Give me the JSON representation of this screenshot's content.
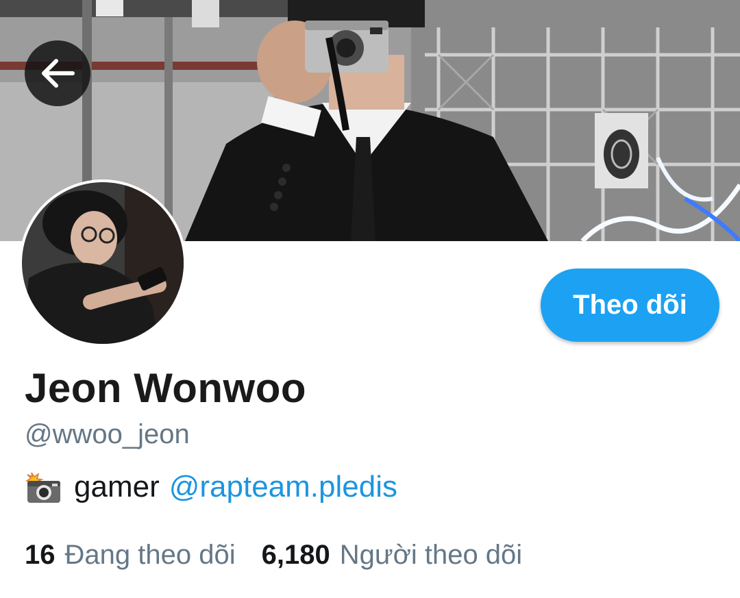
{
  "header": {
    "back_icon": "arrow-left-icon"
  },
  "profile": {
    "display_name": "Jeon Wonwoo",
    "handle": "@wwoo_jeon",
    "bio_emoji_icon": "camera-with-flash-icon",
    "bio_text": "gamer",
    "bio_mention": "@rapteam.pledis",
    "follow_label": "Theo dõi",
    "following_count": "16",
    "following_label": "Đang theo dõi",
    "followers_count": "6,180",
    "followers_label": "Người theo dõi"
  },
  "colors": {
    "accent": "#1da1f2",
    "mention": "#1b95e0",
    "secondary_text": "#657786",
    "primary_text": "#14171a"
  }
}
